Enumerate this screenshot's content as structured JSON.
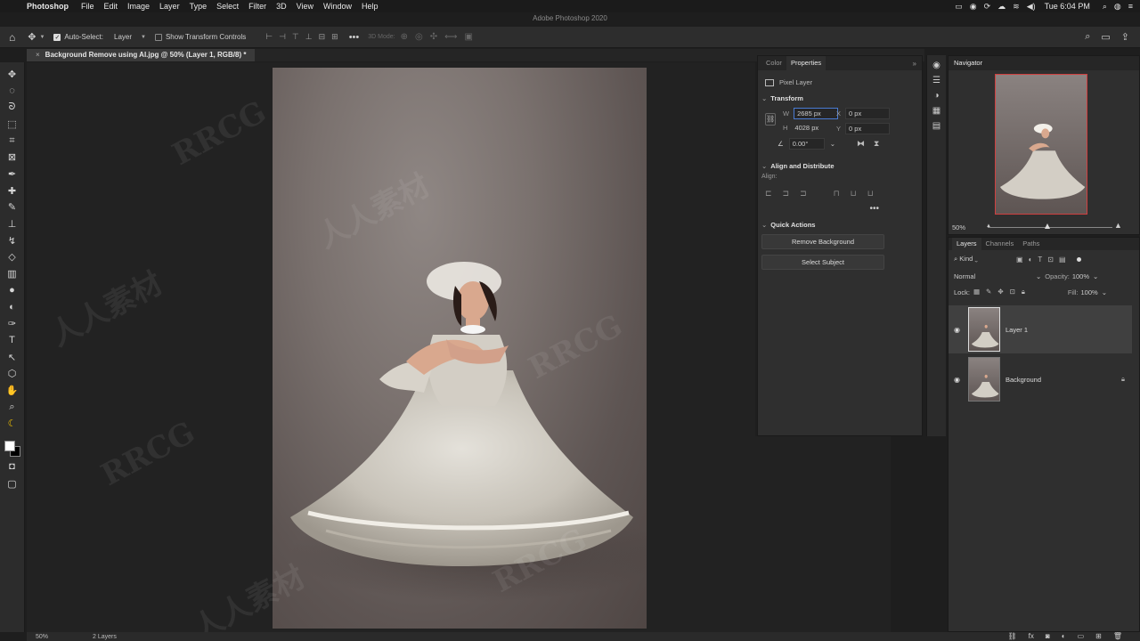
{
  "menubar": {
    "app_name": "Photoshop",
    "items": [
      "File",
      "Edit",
      "Image",
      "Layer",
      "Type",
      "Select",
      "Filter",
      "3D",
      "View",
      "Window",
      "Help"
    ],
    "clock": "Tue 6:04 PM"
  },
  "window": {
    "title": "Adobe Photoshop 2020"
  },
  "options": {
    "auto_select_label": "Auto-Select:",
    "auto_select_target": "Layer",
    "show_transform_label": "Show Transform Controls",
    "mode_3d_label": "3D Mode:"
  },
  "document": {
    "tab_title": "Background Remove using AI.jpg @ 50% (Layer 1, RGB/8) *"
  },
  "properties": {
    "tabs": [
      "Color",
      "Properties"
    ],
    "pixel_layer_label": "Pixel Layer",
    "transform": {
      "title": "Transform",
      "w_label": "W",
      "w_value": "2685 px",
      "h_label": "H",
      "h_value": "4028 px",
      "x_label": "X",
      "x_value": "0 px",
      "y_label": "Y",
      "y_value": "0 px",
      "angle_value": "0.00°"
    },
    "align": {
      "title": "Align and Distribute",
      "label": "Align:"
    },
    "quick_actions": {
      "title": "Quick Actions",
      "remove_bg_label": "Remove Background",
      "select_subject_label": "Select Subject"
    }
  },
  "navigator": {
    "title": "Navigator",
    "zoom": "50%"
  },
  "layers": {
    "tabs": [
      "Layers",
      "Channels",
      "Paths"
    ],
    "filter_kind": "Kind",
    "blend_mode": "Normal",
    "opacity_label": "Opacity:",
    "opacity_value": "100%",
    "lock_label": "Lock:",
    "fill_label": "Fill:",
    "fill_value": "100%",
    "items": [
      {
        "name": "Layer 1"
      },
      {
        "name": "Background"
      }
    ]
  },
  "status": {
    "zoom": "50%",
    "layers_count": "2 Layers"
  },
  "colors": {
    "accent_blue": "#4a7bd2",
    "nav_frame": "#d04040",
    "foreground_swatch": "#ffffff",
    "background_swatch": "#000000"
  }
}
